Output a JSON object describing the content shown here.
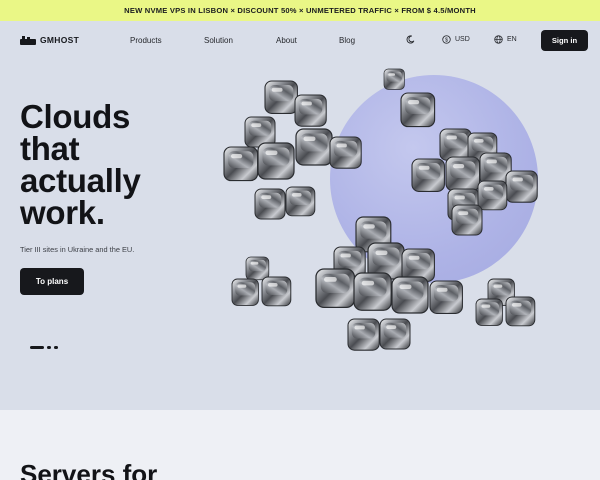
{
  "promo": {
    "text": "NEW NVME VPS IN LISBON × DISCOUNT 50% × UNMETERED TRAFFIC × FROM $ 4.5/MONTH"
  },
  "header": {
    "logo_text": "GMHOST",
    "menu": [
      "Products",
      "Solution",
      "About",
      "Blog"
    ],
    "currency": "USD",
    "language": "EN",
    "sign_in": "Sign in",
    "icons": {
      "theme": "moon-icon",
      "currency": "dollar-icon",
      "language": "globe-icon"
    }
  },
  "hero": {
    "headline": [
      "Clouds",
      "that",
      "actually",
      "work."
    ],
    "subtitle": "Tier III sites in Ukraine and the EU.",
    "cta": "To plans",
    "slides": {
      "count": 3,
      "active": 1
    }
  },
  "next_section": {
    "title": "Servers for"
  },
  "colors": {
    "promo_bg": "#eaf786",
    "hero_bg": "#d9dee9",
    "accent_circle": "#aeb3e6",
    "button_bg": "#17181c"
  }
}
